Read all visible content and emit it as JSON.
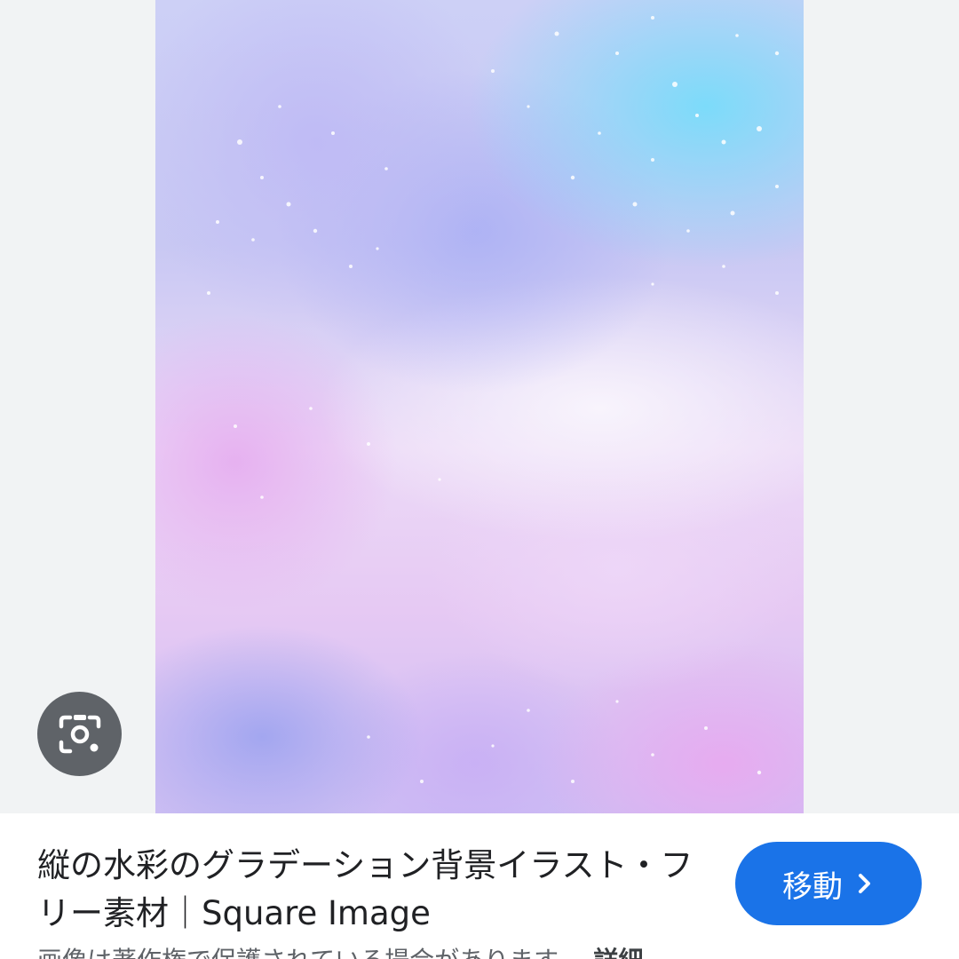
{
  "preview": {
    "image_description_icon": "watercolor-gradient-image"
  },
  "lens": {
    "icon": "camera-search-icon"
  },
  "result": {
    "title": "縦の水彩のグラデーション背景イラスト・フリー素材｜Square Image",
    "visit_label": "移動",
    "visit_icon": "chevron-right-icon",
    "copyright_text": "画像は著作権で保護されている場合があります。",
    "details_label": "詳細"
  },
  "colors": {
    "accent": "#1a73e8",
    "lens_bg": "#5f6368",
    "panel_bg": "#ffffff",
    "viewer_bg": "#f1f3f4"
  }
}
